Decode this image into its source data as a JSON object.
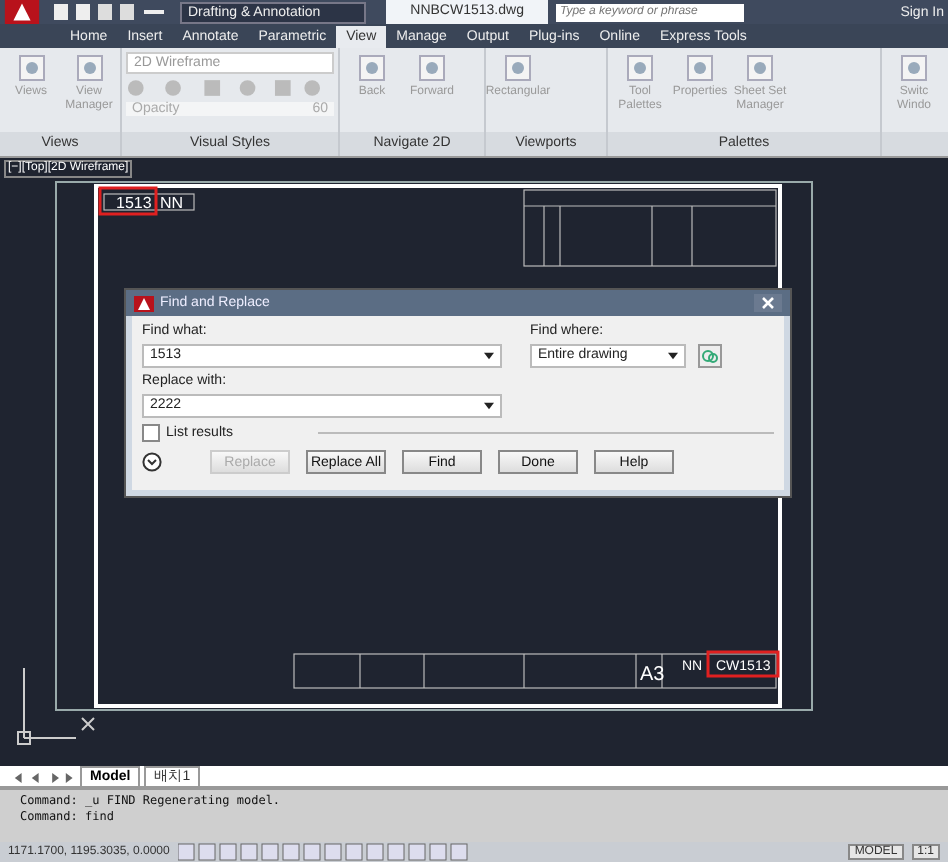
{
  "title_bar": {
    "workspace": "Drafting & Annotation",
    "file_name": "NNBCW1513.dwg",
    "search": {
      "placeholder": "Type a keyword or phrase"
    },
    "sign_in": "Sign In"
  },
  "tabs": [
    {
      "label": "Home",
      "selected": false
    },
    {
      "label": "Insert",
      "selected": false
    },
    {
      "label": "Annotate",
      "selected": false
    },
    {
      "label": "Parametric",
      "selected": false
    },
    {
      "label": "View",
      "selected": true
    },
    {
      "label": "Manage",
      "selected": false
    },
    {
      "label": "Output",
      "selected": false
    },
    {
      "label": "Plug-ins",
      "selected": false
    },
    {
      "label": "Online",
      "selected": false
    },
    {
      "label": "Express Tools",
      "selected": false
    }
  ],
  "panels": [
    {
      "label": "Views",
      "items": [
        {
          "kind": "big",
          "label": "Views"
        },
        {
          "kind": "big",
          "label": "View Manager"
        }
      ]
    },
    {
      "label": "Visual Styles",
      "items": [
        {
          "kind": "styles",
          "value": "2D Wireframe",
          "field_label": "Opacity",
          "reading": "60"
        }
      ]
    },
    {
      "label": "Navigate 2D",
      "items": [
        {
          "kind": "big",
          "label": "Back"
        },
        {
          "kind": "big",
          "label": "Forward"
        }
      ]
    },
    {
      "label": "Viewports",
      "items": [
        {
          "kind": "big",
          "label": "Rectangular"
        }
      ]
    },
    {
      "label": "Palettes",
      "items": [
        {
          "kind": "big",
          "label": "Tool Palettes"
        },
        {
          "kind": "big",
          "label": "Properties"
        },
        {
          "kind": "big",
          "label": "Sheet Set Manager"
        }
      ]
    },
    {
      "items": [
        {
          "kind": "big",
          "label": "Switc Windo"
        }
      ]
    }
  ],
  "viewport": {
    "label": "[−][Top][2D Wireframe]",
    "drawing_texts": [
      {
        "kind": "top",
        "text": "1513"
      },
      {
        "kind": "top2",
        "text": "NN"
      },
      {
        "kind": "size",
        "text": "A3"
      },
      {
        "kind": "name",
        "text": "NN"
      },
      {
        "kind": "name2",
        "text": "CW1513"
      }
    ]
  },
  "dialog": {
    "title": "Find and Replace",
    "find_label": "Find what:",
    "find_value": "1513",
    "where_label": "Find where:",
    "where_value": "Entire drawing",
    "replace_label": "Replace with:",
    "replace_value": "2222",
    "list_results": {
      "label": "List results",
      "checked": false
    },
    "buttons": [
      {
        "label": "Replace",
        "disabled": true
      },
      {
        "label": "Replace All",
        "disabled": false
      },
      {
        "label": "Find",
        "disabled": false
      },
      {
        "label": "Done",
        "disabled": false
      },
      {
        "label": "Help",
        "disabled": false
      }
    ]
  },
  "layout_tabs": [
    {
      "label": "Model",
      "selected": true
    },
    {
      "label": "배치1",
      "selected": false
    }
  ],
  "command_lines": [
    "Command: _u FIND Regenerating model.",
    "Command: find"
  ],
  "status_bar": {
    "coordinates": "1171.1700, 1195.3035, 0.0000",
    "space": "MODEL",
    "scale": "1:1"
  }
}
